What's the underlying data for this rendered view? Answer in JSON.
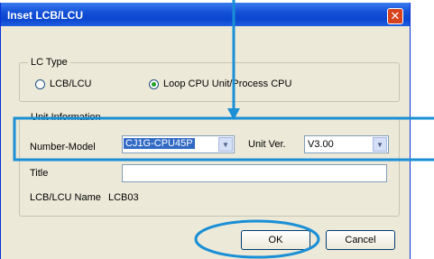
{
  "dialog": {
    "title": "Inset LCB/LCU",
    "close_glyph": "✕"
  },
  "lc_type": {
    "legend": "LC Type",
    "options": [
      {
        "label": "LCB/LCU",
        "selected": false
      },
      {
        "label": "Loop CPU Unit/Process CPU",
        "selected": true
      }
    ]
  },
  "unit_info": {
    "legend": "Unit Information",
    "number_model_label": "Number-Model",
    "number_model_value": "CJ1G-CPU45P",
    "unit_ver_label": "Unit Ver.",
    "unit_ver_value": "V3.00",
    "title_label": "Title",
    "title_value": "",
    "name_label": "LCB/LCU Name",
    "name_value": "LCB03"
  },
  "buttons": {
    "ok": "OK",
    "cancel": "Cancel"
  },
  "annotation": {
    "color": "#1a8fd6",
    "arrow_icon": "down-arrow-icon"
  }
}
